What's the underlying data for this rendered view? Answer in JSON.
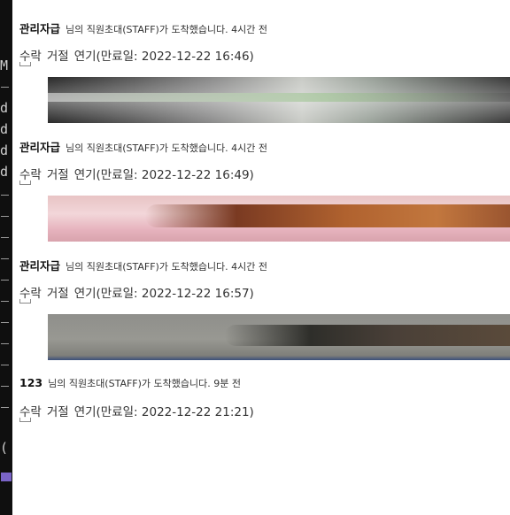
{
  "left_strip": {
    "glyphs": [
      "M",
      "d",
      "d",
      "d",
      "d",
      "("
    ]
  },
  "notifications": [
    {
      "sender": "관리자급",
      "message": "님의 직원초대(STAFF)가 도착했습니다. 4시간 전",
      "accept": "수락",
      "reject": "거절",
      "expire": "연기(만료일: 2022-12-22 16:46)",
      "has_thumbnail": true
    },
    {
      "sender": "관리자급",
      "message": "님의 직원초대(STAFF)가 도착했습니다. 4시간 전",
      "accept": "수락",
      "reject": "거절",
      "expire": "연기(만료일: 2022-12-22 16:49)",
      "has_thumbnail": true
    },
    {
      "sender": "관리자급",
      "message": "님의 직원초대(STAFF)가 도착했습니다. 4시간 전",
      "accept": "수락",
      "reject": "거절",
      "expire": "연기(만료일: 2022-12-22 16:57)",
      "has_thumbnail": true
    },
    {
      "sender": "123",
      "message": "님의 직원초대(STAFF)가 도착했습니다. 9분 전",
      "accept": "수락",
      "reject": "거절",
      "expire": "연기(만료일: 2022-12-22 21:21)",
      "has_thumbnail": false
    }
  ]
}
